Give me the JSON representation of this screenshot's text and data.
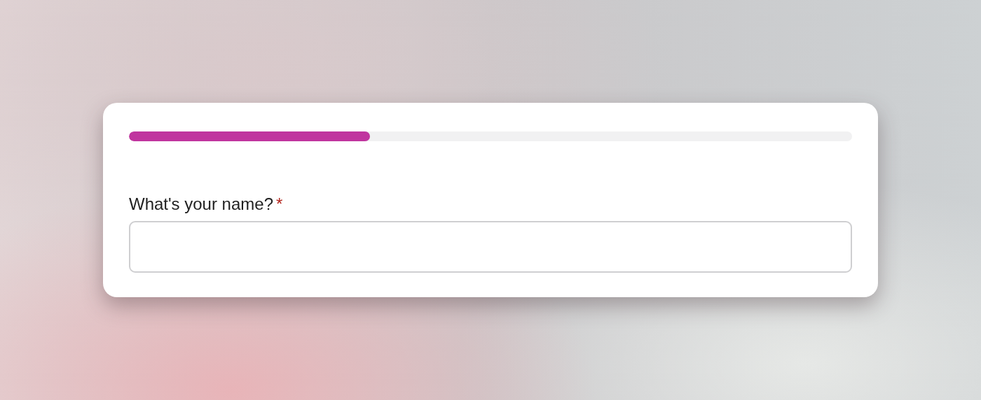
{
  "progress": {
    "level": 0.333
  },
  "question": {
    "label": "What's your name?",
    "required_mark": "*"
  }
}
